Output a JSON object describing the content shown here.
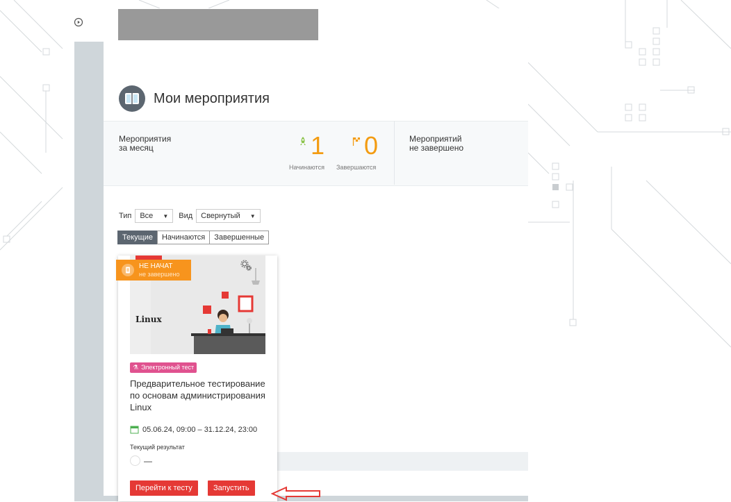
{
  "page": {
    "title": "Мои мероприятия",
    "icons": {
      "sidebar_toggle": "play-circle-icon",
      "title": "book-icon"
    }
  },
  "stats": {
    "month_label_1": "Мероприятия",
    "month_label_2": "за месяц",
    "starting_count": "1",
    "starting_label": "Начинаются",
    "ending_count": "0",
    "ending_label": "Завершаются",
    "incomplete_label_1": "Мероприятий",
    "incomplete_label_2": "не завершено",
    "accent_color": "#f39c12"
  },
  "filters": {
    "type_label": "Тип",
    "type_value": "Все",
    "view_label": "Вид",
    "view_value": "Свернутый"
  },
  "tabs": [
    {
      "label": "Текущие",
      "active": true
    },
    {
      "label": "Начинаются",
      "active": false
    },
    {
      "label": "Завершенные",
      "active": false
    }
  ],
  "card": {
    "status_main": "НЕ НАЧАТ",
    "status_sub": "не завершено",
    "image_text": "Linux",
    "type_tag": "Электронный тест",
    "title": "Предварительное тестирование по основам администрирования Linux",
    "dates": "05.06.24, 09:00 – 31.12.24, 23:00",
    "result_label": "Текущий результат",
    "result_value": "—",
    "go_to_test": "Перейти к тесту",
    "launch": "Запустить",
    "status_color": "#f7941d",
    "tag_color": "#e0528f",
    "button_color": "#e53935"
  }
}
